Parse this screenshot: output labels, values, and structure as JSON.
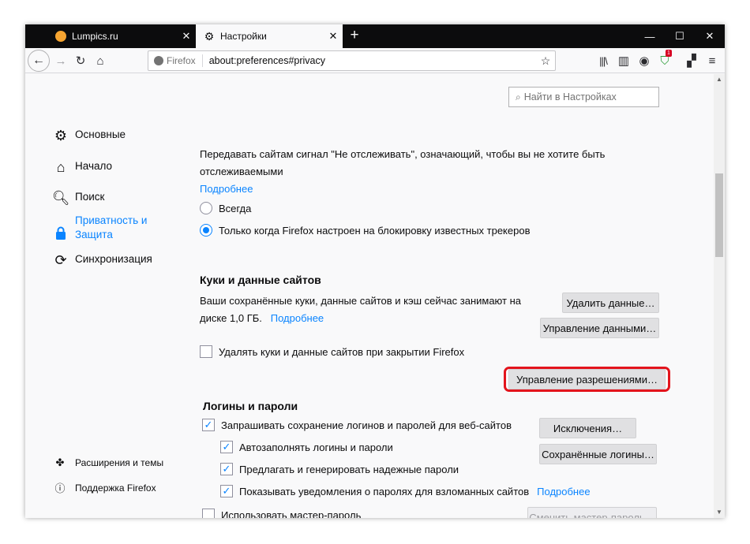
{
  "tabs": [
    {
      "title": "Lumpics.ru",
      "favicon_color": "#f7a531"
    },
    {
      "title": "Настройки"
    }
  ],
  "window_controls": {
    "minimize": "—",
    "maximize": "☐",
    "close": "✕"
  },
  "toolbar": {
    "identity_label": "Firefox",
    "url": "about:preferences#privacy",
    "vpn_badge": "1"
  },
  "search": {
    "placeholder": "Найти в Настройках"
  },
  "sidebar": {
    "items": [
      {
        "label": "Основные",
        "icon": "gear-icon"
      },
      {
        "label": "Начало",
        "icon": "home-icon"
      },
      {
        "label": "Поиск",
        "icon": "search-icon"
      },
      {
        "label": "Приватность и\nЗащита",
        "icon": "lock-icon",
        "selected": true
      },
      {
        "label": "Синхронизация",
        "icon": "sync-icon"
      }
    ],
    "footer": [
      {
        "label": "Расширения и темы",
        "icon": "puzzle-icon"
      },
      {
        "label": "Поддержка Firefox",
        "icon": "help-icon"
      }
    ]
  },
  "dnt": {
    "text_line1": "Передавать сайтам сигнал \"Не отслеживать\", означающий, чтобы вы не хотите быть",
    "text_line2": "отслеживаемыми",
    "learn_more": "Подробнее",
    "option_always": "Всегда",
    "option_only": "Только когда Firefox настроен на блокировку известных трекеров",
    "selected": "only"
  },
  "cookies": {
    "heading": "Куки и данные сайтов",
    "desc_line1": "Ваши сохранённые куки, данные сайтов и кэш сейчас занимают на",
    "desc_line2": "диске 1,0 ГБ.",
    "learn_more": "Подробнее",
    "delete_on_close": "Удалять куки и данные сайтов при закрытии Firefox",
    "delete_on_close_checked": false,
    "btn_clear": "Удалить данные…",
    "btn_manage_data": "Управление данными…",
    "btn_manage_permissions": "Управление разрешениями…"
  },
  "logins": {
    "heading": "Логины и пароли",
    "ask_save": "Запрашивать сохранение логинов и паролей для веб-сайтов",
    "autofill": "Автозаполнять логины и пароли",
    "suggest": "Предлагать и генерировать надежные пароли",
    "breach_alerts": "Показывать уведомления о паролях для взломанных сайтов",
    "breach_learn_more": "Подробнее",
    "master_password": "Использовать мастер-пароль",
    "btn_exceptions": "Исключения…",
    "btn_saved_logins": "Сохранённые логины…",
    "btn_change_master": "Сменить мастер-пароль…"
  },
  "colors": {
    "accent": "#0a84ff",
    "highlight": "#e3141c"
  }
}
